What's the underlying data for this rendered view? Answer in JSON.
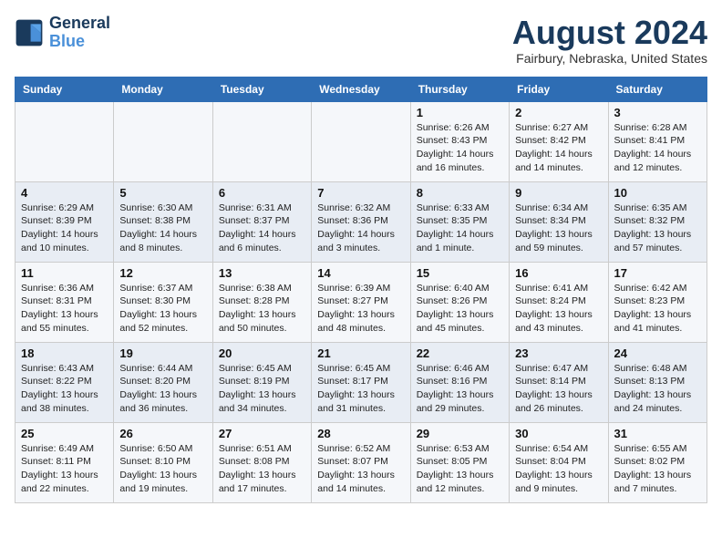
{
  "header": {
    "logo_line1": "General",
    "logo_line2": "Blue",
    "month_year": "August 2024",
    "location": "Fairbury, Nebraska, United States"
  },
  "days_of_week": [
    "Sunday",
    "Monday",
    "Tuesday",
    "Wednesday",
    "Thursday",
    "Friday",
    "Saturday"
  ],
  "weeks": [
    [
      {
        "day": "",
        "detail": ""
      },
      {
        "day": "",
        "detail": ""
      },
      {
        "day": "",
        "detail": ""
      },
      {
        "day": "",
        "detail": ""
      },
      {
        "day": "1",
        "detail": "Sunrise: 6:26 AM\nSunset: 8:43 PM\nDaylight: 14 hours and 16 minutes."
      },
      {
        "day": "2",
        "detail": "Sunrise: 6:27 AM\nSunset: 8:42 PM\nDaylight: 14 hours and 14 minutes."
      },
      {
        "day": "3",
        "detail": "Sunrise: 6:28 AM\nSunset: 8:41 PM\nDaylight: 14 hours and 12 minutes."
      }
    ],
    [
      {
        "day": "4",
        "detail": "Sunrise: 6:29 AM\nSunset: 8:39 PM\nDaylight: 14 hours and 10 minutes."
      },
      {
        "day": "5",
        "detail": "Sunrise: 6:30 AM\nSunset: 8:38 PM\nDaylight: 14 hours and 8 minutes."
      },
      {
        "day": "6",
        "detail": "Sunrise: 6:31 AM\nSunset: 8:37 PM\nDaylight: 14 hours and 6 minutes."
      },
      {
        "day": "7",
        "detail": "Sunrise: 6:32 AM\nSunset: 8:36 PM\nDaylight: 14 hours and 3 minutes."
      },
      {
        "day": "8",
        "detail": "Sunrise: 6:33 AM\nSunset: 8:35 PM\nDaylight: 14 hours and 1 minute."
      },
      {
        "day": "9",
        "detail": "Sunrise: 6:34 AM\nSunset: 8:34 PM\nDaylight: 13 hours and 59 minutes."
      },
      {
        "day": "10",
        "detail": "Sunrise: 6:35 AM\nSunset: 8:32 PM\nDaylight: 13 hours and 57 minutes."
      }
    ],
    [
      {
        "day": "11",
        "detail": "Sunrise: 6:36 AM\nSunset: 8:31 PM\nDaylight: 13 hours and 55 minutes."
      },
      {
        "day": "12",
        "detail": "Sunrise: 6:37 AM\nSunset: 8:30 PM\nDaylight: 13 hours and 52 minutes."
      },
      {
        "day": "13",
        "detail": "Sunrise: 6:38 AM\nSunset: 8:28 PM\nDaylight: 13 hours and 50 minutes."
      },
      {
        "day": "14",
        "detail": "Sunrise: 6:39 AM\nSunset: 8:27 PM\nDaylight: 13 hours and 48 minutes."
      },
      {
        "day": "15",
        "detail": "Sunrise: 6:40 AM\nSunset: 8:26 PM\nDaylight: 13 hours and 45 minutes."
      },
      {
        "day": "16",
        "detail": "Sunrise: 6:41 AM\nSunset: 8:24 PM\nDaylight: 13 hours and 43 minutes."
      },
      {
        "day": "17",
        "detail": "Sunrise: 6:42 AM\nSunset: 8:23 PM\nDaylight: 13 hours and 41 minutes."
      }
    ],
    [
      {
        "day": "18",
        "detail": "Sunrise: 6:43 AM\nSunset: 8:22 PM\nDaylight: 13 hours and 38 minutes."
      },
      {
        "day": "19",
        "detail": "Sunrise: 6:44 AM\nSunset: 8:20 PM\nDaylight: 13 hours and 36 minutes."
      },
      {
        "day": "20",
        "detail": "Sunrise: 6:45 AM\nSunset: 8:19 PM\nDaylight: 13 hours and 34 minutes."
      },
      {
        "day": "21",
        "detail": "Sunrise: 6:45 AM\nSunset: 8:17 PM\nDaylight: 13 hours and 31 minutes."
      },
      {
        "day": "22",
        "detail": "Sunrise: 6:46 AM\nSunset: 8:16 PM\nDaylight: 13 hours and 29 minutes."
      },
      {
        "day": "23",
        "detail": "Sunrise: 6:47 AM\nSunset: 8:14 PM\nDaylight: 13 hours and 26 minutes."
      },
      {
        "day": "24",
        "detail": "Sunrise: 6:48 AM\nSunset: 8:13 PM\nDaylight: 13 hours and 24 minutes."
      }
    ],
    [
      {
        "day": "25",
        "detail": "Sunrise: 6:49 AM\nSunset: 8:11 PM\nDaylight: 13 hours and 22 minutes."
      },
      {
        "day": "26",
        "detail": "Sunrise: 6:50 AM\nSunset: 8:10 PM\nDaylight: 13 hours and 19 minutes."
      },
      {
        "day": "27",
        "detail": "Sunrise: 6:51 AM\nSunset: 8:08 PM\nDaylight: 13 hours and 17 minutes."
      },
      {
        "day": "28",
        "detail": "Sunrise: 6:52 AM\nSunset: 8:07 PM\nDaylight: 13 hours and 14 minutes."
      },
      {
        "day": "29",
        "detail": "Sunrise: 6:53 AM\nSunset: 8:05 PM\nDaylight: 13 hours and 12 minutes."
      },
      {
        "day": "30",
        "detail": "Sunrise: 6:54 AM\nSunset: 8:04 PM\nDaylight: 13 hours and 9 minutes."
      },
      {
        "day": "31",
        "detail": "Sunrise: 6:55 AM\nSunset: 8:02 PM\nDaylight: 13 hours and 7 minutes."
      }
    ]
  ]
}
